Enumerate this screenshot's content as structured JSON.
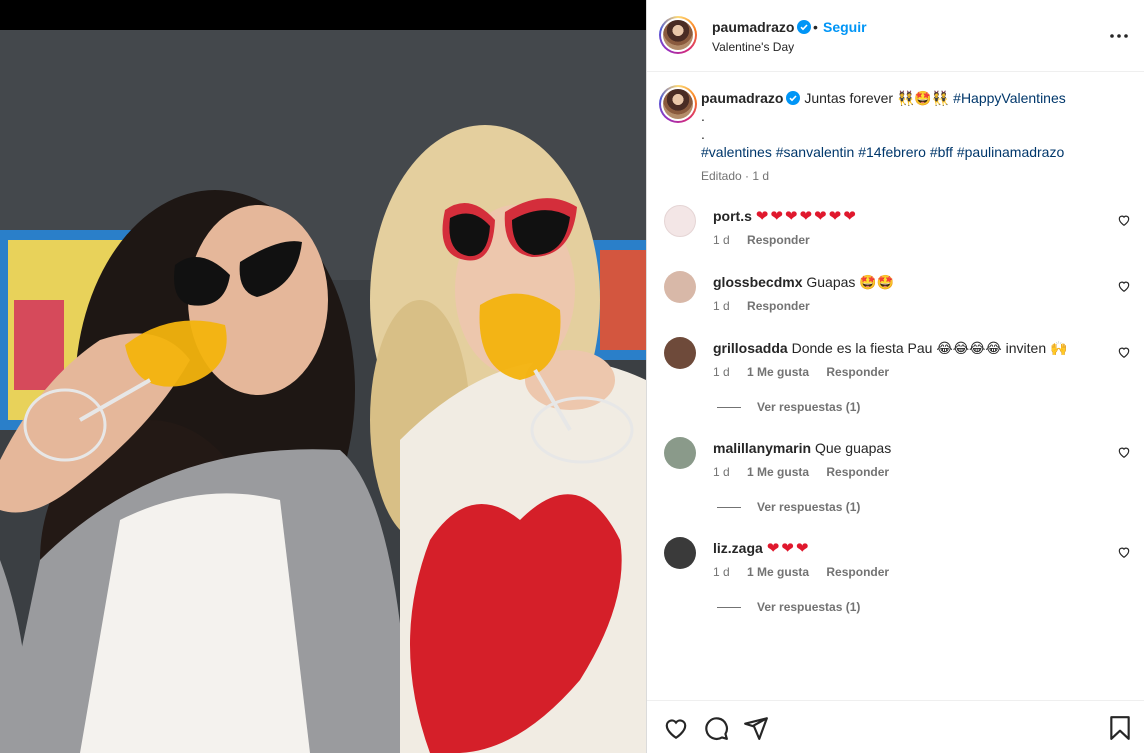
{
  "post": {
    "username": "paumadrazo",
    "follow_label": "Seguir",
    "dot": "•",
    "location": "Valentine's Day"
  },
  "caption": {
    "username": "paumadrazo",
    "text": "Juntas forever",
    "emojis": "👯🤩👯",
    "hashtag_main": "#HappyValentines",
    "dot1": ".",
    "dot2": ".",
    "hashtags": [
      "#valentines",
      "#sanvalentin",
      "#14febrero",
      "#bff",
      "#paulinamadrazo"
    ],
    "meta": "Editado · 1 d"
  },
  "comments": [
    {
      "username": "port.s",
      "text": "❤❤❤❤❤❤❤",
      "time": "1 d",
      "likes": "",
      "reply": "Responder",
      "replies": ""
    },
    {
      "username": "glossbecdmx",
      "text": "Guapas 🤩🤩",
      "time": "1 d",
      "likes": "",
      "reply": "Responder",
      "replies": ""
    },
    {
      "username": "grillosadda",
      "text": "Donde es la fiesta Pau 😂😂😂😂 inviten 🙌",
      "time": "1 d",
      "likes": "1 Me gusta",
      "reply": "Responder",
      "replies": "Ver respuestas (1)"
    },
    {
      "username": "malillanymarin",
      "text": "Que guapas",
      "time": "1 d",
      "likes": "1 Me gusta",
      "reply": "Responder",
      "replies": "Ver respuestas (1)"
    },
    {
      "username": "liz.zaga",
      "text": "❤❤❤",
      "time": "1 d",
      "likes": "1 Me gusta",
      "reply": "Responder",
      "replies": "Ver respuestas (1)"
    }
  ],
  "icons": {
    "more": "more-options-icon",
    "like": "heart-icon",
    "comment": "comment-icon",
    "share": "share-icon",
    "save": "bookmark-icon",
    "verified": "verified-badge-icon"
  },
  "colors": {
    "accent": "#0095f6",
    "hashtag": "#00376b",
    "heart": "#e0182d"
  }
}
